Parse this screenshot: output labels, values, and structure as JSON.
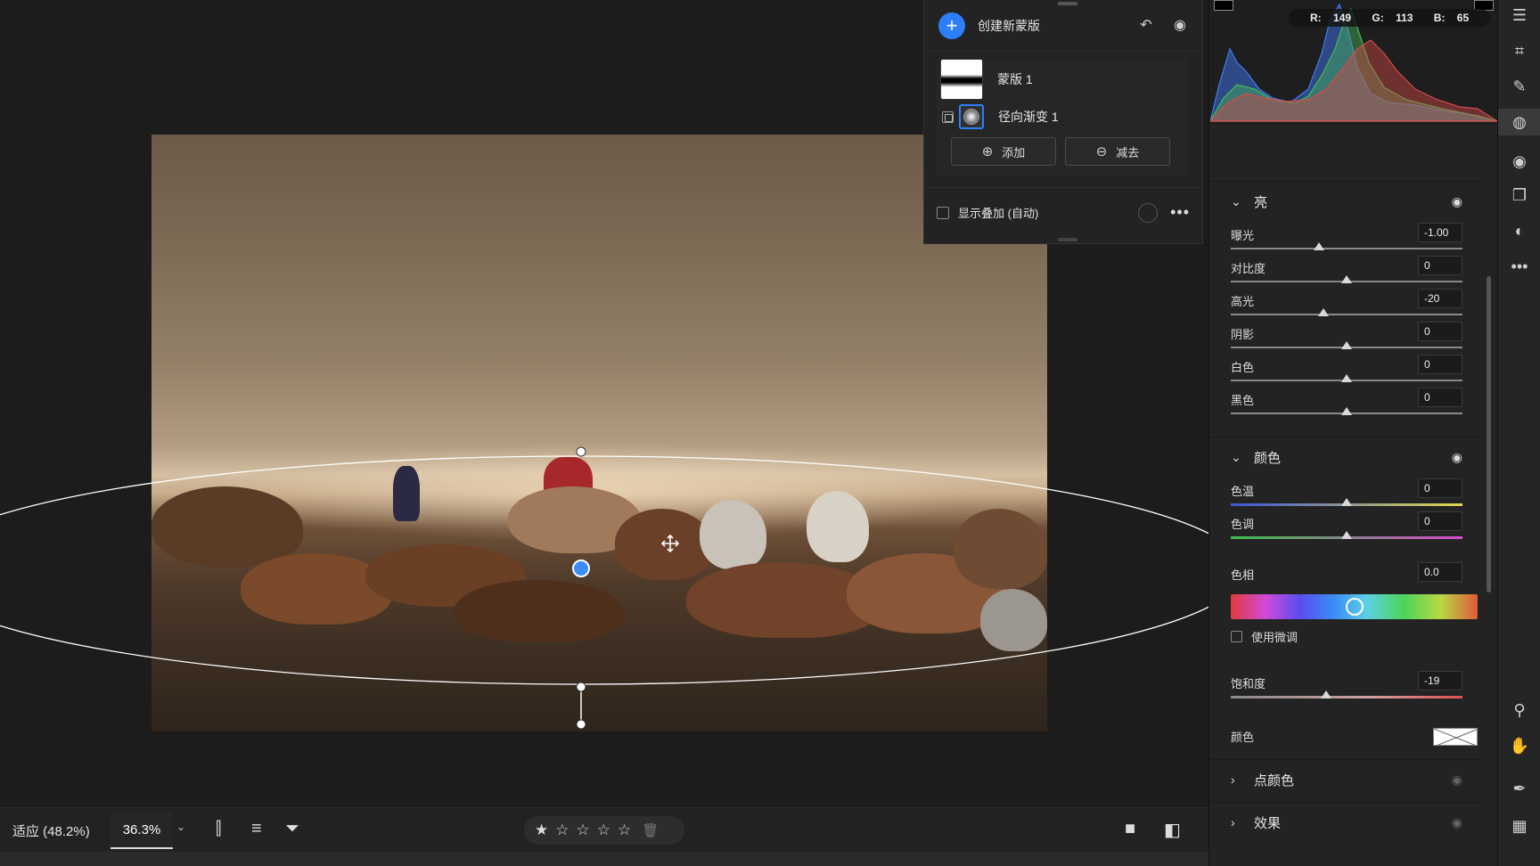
{
  "mask_panel": {
    "create_label": "创建新蒙版",
    "mask_name": "蒙版 1",
    "component_name": "径向渐变 1",
    "add_label": "添加",
    "subtract_label": "减去",
    "overlay_label": "显示叠加 (自动)"
  },
  "histogram": {
    "r_label": "R:",
    "r_value": "149",
    "g_label": "G:",
    "g_value": "113",
    "b_label": "B:",
    "b_value": "65"
  },
  "light": {
    "title": "亮",
    "sliders": [
      {
        "label": "曝光",
        "value": "-1.00",
        "position": 0.38
      },
      {
        "label": "对比度",
        "value": "0",
        "position": 0.5
      },
      {
        "label": "高光",
        "value": "-20",
        "position": 0.4
      },
      {
        "label": "阴影",
        "value": "0",
        "position": 0.5
      },
      {
        "label": "白色",
        "value": "0",
        "position": 0.5
      },
      {
        "label": "黑色",
        "value": "0",
        "position": 0.5
      }
    ]
  },
  "color": {
    "title": "颜色",
    "temperature": {
      "label": "色温",
      "value": "0",
      "position": 0.5
    },
    "tint": {
      "label": "色调",
      "value": "0",
      "position": 0.5
    },
    "hue": {
      "label": "色相",
      "value": "0.0",
      "position": 0.5
    },
    "fine_adjust_label": "使用微调",
    "saturation": {
      "label": "饱和度",
      "value": "-19",
      "position": 0.41
    },
    "color_label": "颜色"
  },
  "collapsed_sections": [
    "点颜色",
    "效果"
  ],
  "bottom_bar": {
    "fit_label": "适应 (48.2%)",
    "zoom_value": "36.3%"
  },
  "rating": {
    "stars_filled": 1,
    "stars_total": 5
  },
  "colors": {
    "accent": "#2d7ff9",
    "panel_bg": "#232323",
    "canvas_bg": "#1c1c1c"
  },
  "icons": {
    "toolstrip": [
      "sliders-icon",
      "crop-icon",
      "healing-icon",
      "masking-icon",
      "red-eye-icon",
      "presets-icon",
      "color-mix-icon",
      "more-icon",
      "zoom-icon",
      "hand-icon",
      "color-sampler-icon",
      "grid-icon"
    ]
  }
}
